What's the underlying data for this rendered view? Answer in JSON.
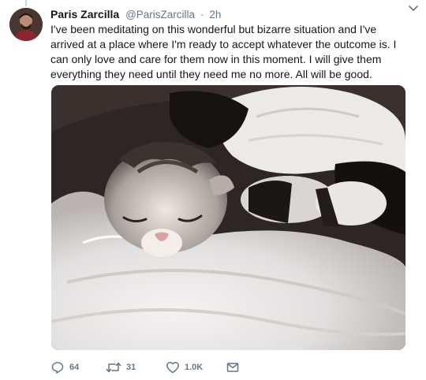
{
  "tweet": {
    "author_name": "Paris Zarcilla",
    "author_handle": "@ParisZarcilla",
    "separator": "·",
    "timestamp": "2h",
    "text": "I've been meditating on this wonderful but bizarre situation and I've arrived at a place where I'm ready to accept whatever the outcome is. I can only love and care for them now in this moment. I will give them everything they need until they need me no more. All will be good."
  },
  "actions": {
    "replies": "64",
    "retweets": "31",
    "likes": "1.0K"
  },
  "icons": {
    "more": "chevron-down-icon",
    "reply": "reply-icon",
    "retweet": "retweet-icon",
    "like": "heart-icon",
    "dm": "envelope-icon"
  },
  "colors": {
    "text_primary": "#14171a",
    "text_secondary": "#657786"
  }
}
